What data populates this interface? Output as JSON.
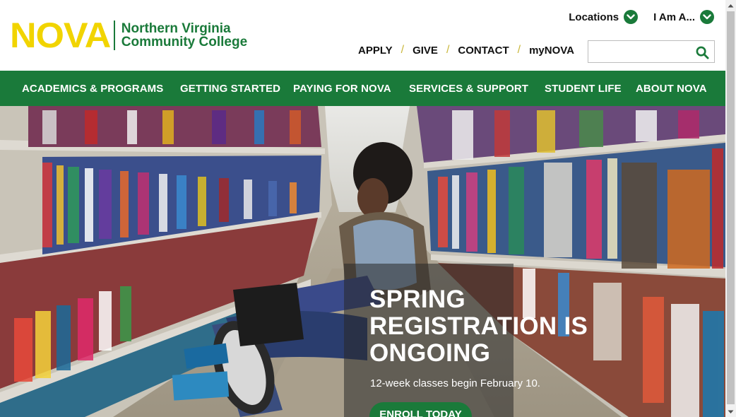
{
  "brand": {
    "logo_mark": "NOVA",
    "name_line1": "Northern Virginia",
    "name_line2": "Community College",
    "primary_color": "#1a7a3a",
    "accent_color": "#f1d400"
  },
  "utility_nav": [
    {
      "label": "Locations",
      "icon": "chevron-down-icon"
    },
    {
      "label": "I Am A...",
      "icon": "chevron-down-icon"
    }
  ],
  "top_links": [
    "APPLY",
    "GIVE",
    "CONTACT",
    "myNOVA"
  ],
  "top_links_separator": "/",
  "search": {
    "placeholder": "",
    "value": "",
    "icon": "search-icon"
  },
  "main_nav": [
    "ACADEMICS & PROGRAMS",
    "GETTING STARTED",
    "PAYING FOR NOVA",
    "SERVICES & SUPPORT",
    "STUDENT LIFE",
    "ABOUT NOVA"
  ],
  "hero": {
    "title_line1": "SPRING",
    "title_line2": "REGISTRATION IS",
    "title_line3": "ONGOING",
    "subtitle": "12-week classes begin February 10.",
    "cta_label": "ENROLL TODAY"
  }
}
